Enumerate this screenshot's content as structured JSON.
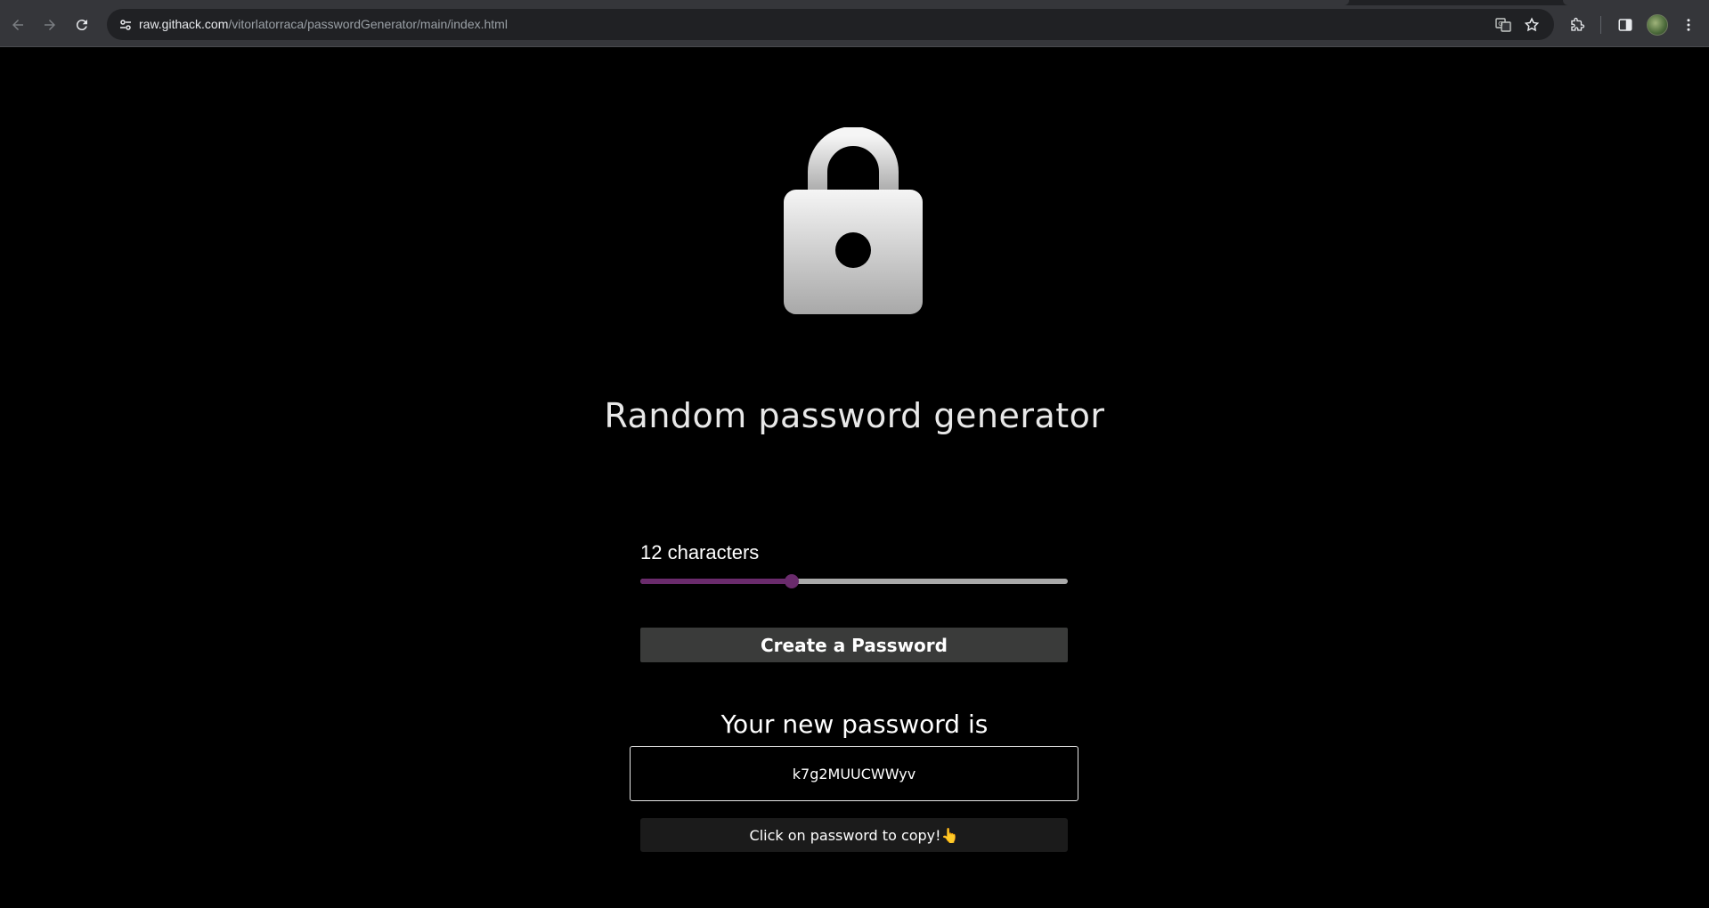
{
  "browser": {
    "url_host": "raw.githack.com",
    "url_path": "/vitorlatorraca/passwordGenerator/main/index.html",
    "icons": [
      "back-icon",
      "forward-icon",
      "reload-icon",
      "site-info-icon",
      "translate-icon",
      "bookmark-star-icon",
      "extensions-icon",
      "side-panel-icon",
      "profile-avatar",
      "more-menu-icon"
    ]
  },
  "page": {
    "title": "Random password generator",
    "length_label": "12 characters",
    "slider": {
      "value": 12,
      "fraction": 0.354,
      "fill_color": "#6a2b6c",
      "track_color": "#a9a9a9"
    },
    "create_button_label": "Create a Password",
    "result_heading": "Your new password is",
    "password": "k7g2MUUCWWyv",
    "copy_hint": "Click on password to copy!👆"
  },
  "colors": {
    "background": "#000000",
    "button_bg": "#3a3b3a",
    "accent": "#6a2b6c"
  }
}
